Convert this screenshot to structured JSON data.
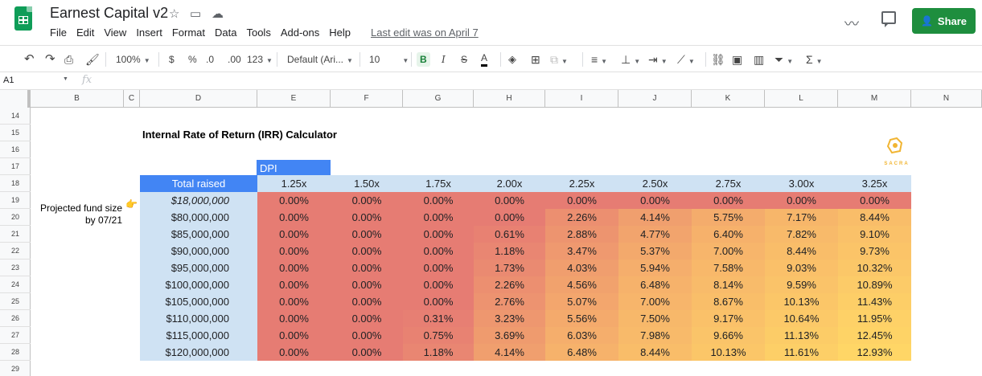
{
  "document": {
    "title": "Earnest Capital v2",
    "menu": [
      "File",
      "Edit",
      "View",
      "Insert",
      "Format",
      "Data",
      "Tools",
      "Add-ons",
      "Help"
    ],
    "last_edit": "Last edit was on April 7",
    "share_label": "Share"
  },
  "toolbar": {
    "zoom": "100%",
    "currency": "$",
    "percent": "%",
    "dec_decrease": ".0",
    "dec_increase": ".00",
    "more_formats": "123",
    "font": "Default (Ari...",
    "font_size": "10",
    "bold": "B",
    "italic": "I",
    "strike": "S",
    "text_color": "A"
  },
  "formula_bar": {
    "name_box": "A1",
    "fx": "fx",
    "value": ""
  },
  "grid": {
    "columns": [
      "B",
      "C",
      "D",
      "E",
      "F",
      "G",
      "H",
      "I",
      "J",
      "K",
      "L",
      "M",
      "N"
    ],
    "rows": [
      "14",
      "15",
      "16",
      "17",
      "18",
      "19",
      "20",
      "21",
      "22",
      "23",
      "24",
      "25",
      "26",
      "27",
      "28",
      "29"
    ]
  },
  "sheet": {
    "title": "Internal Rate of Return (IRR) Calculator",
    "dpi_label": "DPI",
    "side_label": "Projected fund size by 07/21",
    "total_raised_header": "Total raised",
    "logo_text": "SACRA",
    "dpi_headers": [
      "1.25x",
      "1.50x",
      "1.75x",
      "2.00x",
      "2.25x",
      "2.50x",
      "2.75x",
      "3.00x",
      "3.25x"
    ],
    "fund_sizes": [
      "$18,000,000",
      "$80,000,000",
      "$85,000,000",
      "$90,000,000",
      "$95,000,000",
      "$100,000,000",
      "$105,000,000",
      "$110,000,000",
      "$115,000,000",
      "$120,000,000"
    ],
    "irr_values": [
      [
        "0.00%",
        "0.00%",
        "0.00%",
        "0.00%",
        "0.00%",
        "0.00%",
        "0.00%",
        "0.00%",
        "0.00%"
      ],
      [
        "0.00%",
        "0.00%",
        "0.00%",
        "0.00%",
        "2.26%",
        "4.14%",
        "5.75%",
        "7.17%",
        "8.44%"
      ],
      [
        "0.00%",
        "0.00%",
        "0.00%",
        "0.61%",
        "2.88%",
        "4.77%",
        "6.40%",
        "7.82%",
        "9.10%"
      ],
      [
        "0.00%",
        "0.00%",
        "0.00%",
        "1.18%",
        "3.47%",
        "5.37%",
        "7.00%",
        "8.44%",
        "9.73%"
      ],
      [
        "0.00%",
        "0.00%",
        "0.00%",
        "1.73%",
        "4.03%",
        "5.94%",
        "7.58%",
        "9.03%",
        "10.32%"
      ],
      [
        "0.00%",
        "0.00%",
        "0.00%",
        "2.26%",
        "4.56%",
        "6.48%",
        "8.14%",
        "9.59%",
        "10.89%"
      ],
      [
        "0.00%",
        "0.00%",
        "0.00%",
        "2.76%",
        "5.07%",
        "7.00%",
        "8.67%",
        "10.13%",
        "11.43%"
      ],
      [
        "0.00%",
        "0.00%",
        "0.31%",
        "3.23%",
        "5.56%",
        "7.50%",
        "9.17%",
        "10.64%",
        "11.95%"
      ],
      [
        "0.00%",
        "0.00%",
        "0.75%",
        "3.69%",
        "6.03%",
        "7.98%",
        "9.66%",
        "11.13%",
        "12.45%"
      ],
      [
        "0.00%",
        "0.00%",
        "1.18%",
        "4.14%",
        "6.48%",
        "8.44%",
        "10.13%",
        "11.61%",
        "12.93%"
      ]
    ]
  },
  "colors": {
    "accent_green": "#1e8e3e",
    "header_blue": "#4285f4",
    "light_blue": "#cfe2f3",
    "scale_low": "#e67c73",
    "scale_mid": "#f6b26b",
    "scale_high": "#ffd666"
  },
  "icons": [
    "sheets-logo-icon",
    "star-icon",
    "move-folder-icon",
    "cloud-saved-icon",
    "trend-icon",
    "comment-icon",
    "person-add-icon",
    "pointing-hand-icon"
  ]
}
